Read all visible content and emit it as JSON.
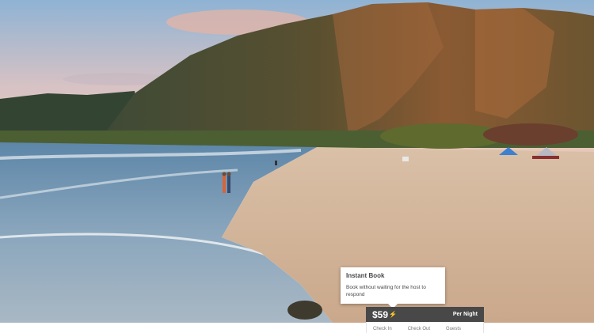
{
  "listing": {
    "photo_alt": "Beach at sunset with green mountains"
  },
  "instant_book_tooltip": {
    "title": "Instant Book",
    "body": "Book without waiting for the host to respond"
  },
  "booking": {
    "price": "$59",
    "bolt_icon": "lightning-bolt-icon",
    "per_night_label": "Per Night",
    "fields": [
      "Check In",
      "Check Out",
      "Guests"
    ]
  },
  "colors": {
    "price_bar": "#484848",
    "bolt": "#ffb400",
    "tooltip_bg": "#ffffff"
  }
}
